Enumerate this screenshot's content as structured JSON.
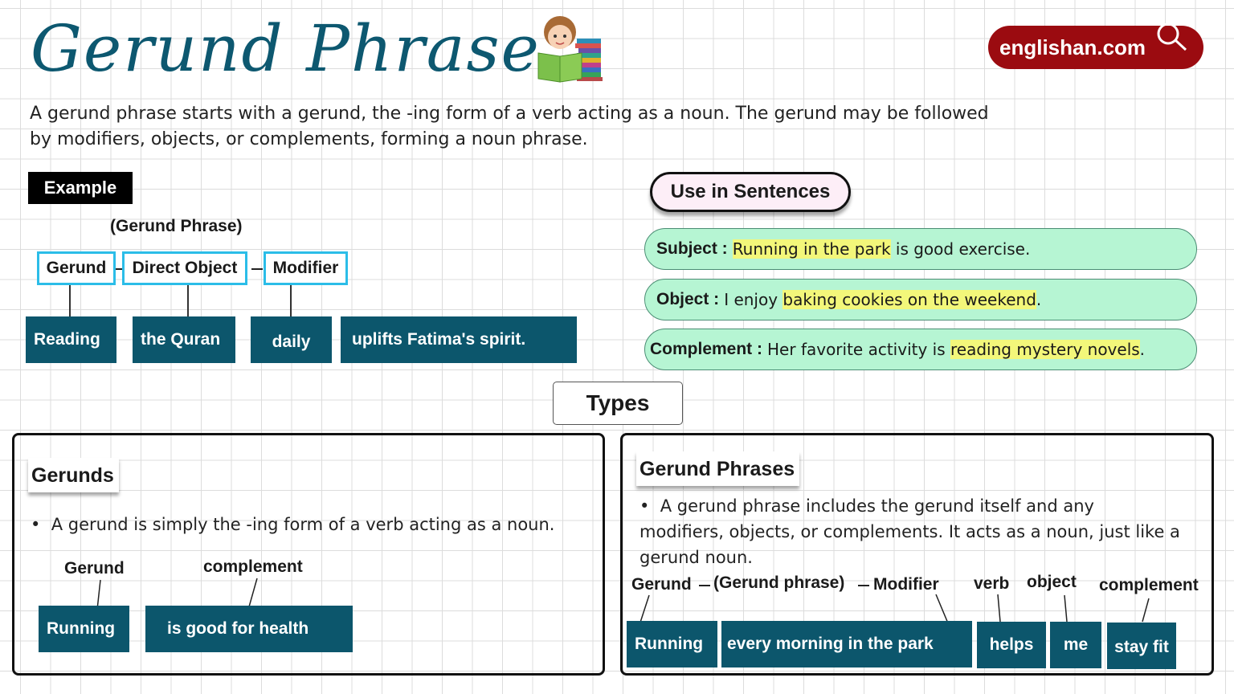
{
  "header": {
    "title": "Gerund Phrase",
    "brand": "englishan.com",
    "mascot": "boy-reading-book-icon"
  },
  "intro": "A gerund phrase starts with a gerund, the -ing form of a verb acting as a noun. The gerund may be followed by modifiers, objects, or complements, forming a noun phrase.",
  "example": {
    "tag": "Example",
    "phrase_label": "(Gerund Phrase)",
    "labels": [
      "Gerund",
      "Direct Object",
      "Modifier"
    ],
    "words": [
      "Reading",
      "the Quran",
      "daily",
      "uplifts Fatima's spirit."
    ]
  },
  "sentences": {
    "heading": "Use in Sentences",
    "items": [
      {
        "role": "Subject :",
        "before": "",
        "highlight": "Running in the park",
        "after": " is good exercise."
      },
      {
        "role": "Object :",
        "before": "I enjoy ",
        "highlight": "baking cookies on the weekend",
        "after": "."
      },
      {
        "role": "Complement :",
        "before": "Her favorite activity is ",
        "highlight": "reading mystery novels",
        "after": "."
      }
    ]
  },
  "types": {
    "heading": "Types",
    "gerunds": {
      "title": "Gerunds",
      "bullet": "A gerund is simply the -ing form of a verb acting as a noun.",
      "labels": [
        "Gerund",
        "complement"
      ],
      "words": [
        "Running",
        "is good for health"
      ]
    },
    "gerund_phrases": {
      "title": "Gerund Phrases",
      "bullet_line1": "A gerund phrase includes the gerund itself and any",
      "bullet_rest": "modifiers, objects, or complements. It acts as a noun, just like a gerund noun.",
      "labels": [
        "Gerund",
        "(Gerund phrase)",
        "Modifier",
        "verb",
        "object",
        "complement"
      ],
      "words": [
        "Running",
        "every morning in the park",
        "helps",
        "me",
        "stay fit"
      ]
    }
  },
  "colors": {
    "title": "#0d5870",
    "word_box": "#0c566c",
    "label_border": "#2bbde8",
    "brand": "#9b0b10",
    "sentence_bg": "#b6f5d3",
    "highlight": "#f3f77a"
  }
}
